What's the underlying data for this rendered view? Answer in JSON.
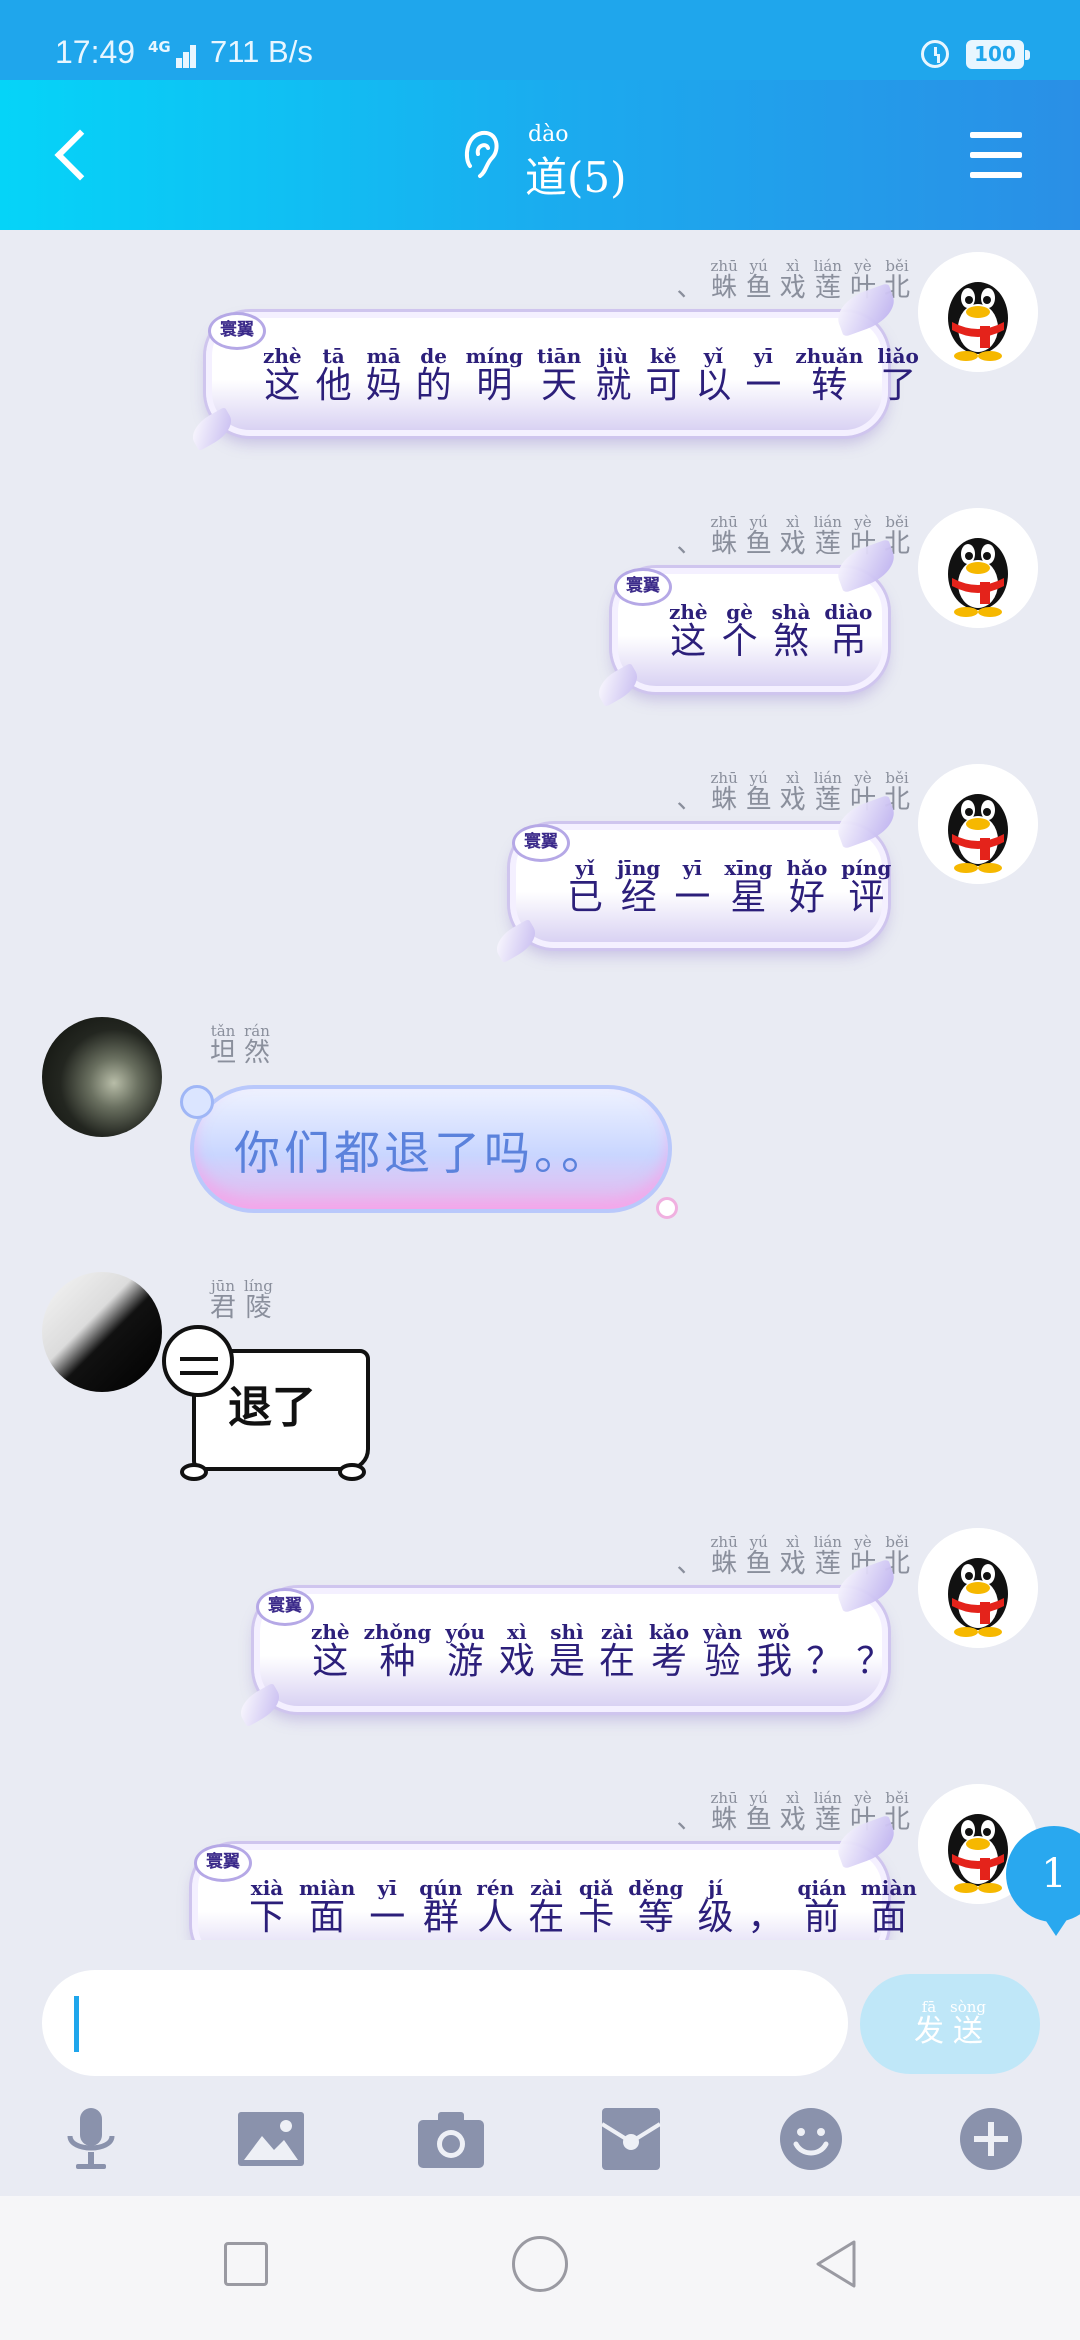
{
  "status_bar": {
    "time": "17:49",
    "network": "4G",
    "speed": "711 B/s",
    "battery": "100"
  },
  "nav": {
    "title_pinyin": "dào",
    "title": "道(5)",
    "icons": [
      "back-arrow-icon",
      "ear-icon",
      "menu-icon"
    ]
  },
  "names": {
    "self": [
      {
        "py": "",
        "hz": "、"
      },
      {
        "py": "zhū",
        "hz": "蛛"
      },
      {
        "py": "yú",
        "hz": "鱼"
      },
      {
        "py": "xì",
        "hz": "戏"
      },
      {
        "py": "lián",
        "hz": "莲"
      },
      {
        "py": "yè",
        "hz": "叶"
      },
      {
        "py": "běi",
        "hz": "北"
      }
    ],
    "tanran": [
      {
        "py": "tǎn",
        "hz": "坦"
      },
      {
        "py": "rán",
        "hz": "然"
      }
    ],
    "junling": [
      {
        "py": "jūn",
        "hz": "君"
      },
      {
        "py": "líng",
        "hz": "陵"
      }
    ]
  },
  "badge_label": "寰翼",
  "messages": [
    {
      "sender": "self",
      "type": "pinyin",
      "chars": [
        {
          "py": "zhè",
          "hz": "这"
        },
        {
          "py": "tā",
          "hz": "他"
        },
        {
          "py": "mā",
          "hz": "妈"
        },
        {
          "py": "de",
          "hz": "的"
        },
        {
          "py": "míng",
          "hz": "明"
        },
        {
          "py": "tiān",
          "hz": "天"
        },
        {
          "py": "jiù",
          "hz": "就"
        },
        {
          "py": "kě",
          "hz": "可"
        },
        {
          "py": "yǐ",
          "hz": "以"
        },
        {
          "py": "yī",
          "hz": "一"
        },
        {
          "py": "zhuǎn",
          "hz": "转"
        },
        {
          "py": "liǎo",
          "hz": "了"
        }
      ]
    },
    {
      "sender": "self",
      "type": "pinyin",
      "chars": [
        {
          "py": "zhè",
          "hz": "这"
        },
        {
          "py": "gè",
          "hz": "个"
        },
        {
          "py": "shà",
          "hz": "煞"
        },
        {
          "py": "diào",
          "hz": "吊"
        }
      ]
    },
    {
      "sender": "self",
      "type": "pinyin",
      "chars": [
        {
          "py": "yǐ",
          "hz": "已"
        },
        {
          "py": "jīng",
          "hz": "经"
        },
        {
          "py": "yī",
          "hz": "一"
        },
        {
          "py": "xīng",
          "hz": "星"
        },
        {
          "py": "hǎo",
          "hz": "好"
        },
        {
          "py": "píng",
          "hz": "评"
        }
      ]
    },
    {
      "sender": "tanran",
      "type": "text",
      "text": "你们都退了吗。。"
    },
    {
      "sender": "junling",
      "type": "sticker",
      "text": "退了"
    },
    {
      "sender": "self",
      "type": "pinyin",
      "chars": [
        {
          "py": "zhè",
          "hz": "这"
        },
        {
          "py": "zhǒng",
          "hz": "种"
        },
        {
          "py": "yóu",
          "hz": "游"
        },
        {
          "py": "xì",
          "hz": "戏"
        },
        {
          "py": "shì",
          "hz": "是"
        },
        {
          "py": "zài",
          "hz": "在"
        },
        {
          "py": "kǎo",
          "hz": "考"
        },
        {
          "py": "yàn",
          "hz": "验"
        },
        {
          "py": "wǒ",
          "hz": "我"
        },
        {
          "py": "",
          "hz": "？"
        },
        {
          "py": "",
          "hz": "？"
        }
      ]
    },
    {
      "sender": "self",
      "type": "pinyin",
      "chars": [
        {
          "py": "xià",
          "hz": "下"
        },
        {
          "py": "miàn",
          "hz": "面"
        },
        {
          "py": "yī",
          "hz": "一"
        },
        {
          "py": "qún",
          "hz": "群"
        },
        {
          "py": "rén",
          "hz": "人"
        },
        {
          "py": "zài",
          "hz": "在"
        },
        {
          "py": "qiǎ",
          "hz": "卡"
        },
        {
          "py": "děng",
          "hz": "等"
        },
        {
          "py": "jí",
          "hz": "级"
        },
        {
          "py": "",
          "hz": "，"
        },
        {
          "py": "qián",
          "hz": "前"
        },
        {
          "py": "miàn",
          "hz": "面"
        }
      ]
    }
  ],
  "unread_count": "1",
  "input": {
    "value": "",
    "send_pinyin": [
      "fā",
      "sòng"
    ],
    "send_chars": [
      "发",
      "送"
    ]
  },
  "toolbar": [
    "microphone-icon",
    "image-icon",
    "camera-icon",
    "red-packet-icon",
    "emoji-icon",
    "plus-icon"
  ],
  "colors": {
    "accent": "#1fa6ec",
    "background": "#e9ebf3",
    "bubble_text": "#2c1f7a",
    "cloud_text": "#5b82dc"
  }
}
